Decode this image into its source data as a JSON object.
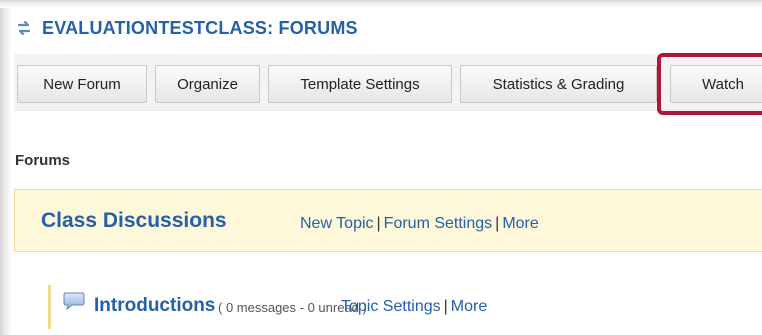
{
  "header": {
    "title": "EVALUATIONTESTCLASS: FORUMS",
    "icon": "sync-arrows-icon"
  },
  "toolbar": {
    "buttons": [
      {
        "label": "New Forum"
      },
      {
        "label": "Organize"
      },
      {
        "label": "Template Settings"
      },
      {
        "label": "Statistics & Grading"
      },
      {
        "label": "Watch"
      }
    ]
  },
  "section": {
    "heading": "Forums"
  },
  "forum": {
    "title": "Class Discussions",
    "links": {
      "new_topic": "New Topic",
      "forum_settings": "Forum Settings",
      "more": "More",
      "separator": "|"
    }
  },
  "topic": {
    "title": "Introductions",
    "meta": "( 0 messages - 0 unread )",
    "icon": "chat-bubble-icon",
    "links": {
      "topic_settings": "Topic Settings",
      "more": "More",
      "separator": "|"
    }
  },
  "colors": {
    "link": "#2660a8",
    "highlight": "#b0163a",
    "forum_bg": "#fdf8da"
  }
}
